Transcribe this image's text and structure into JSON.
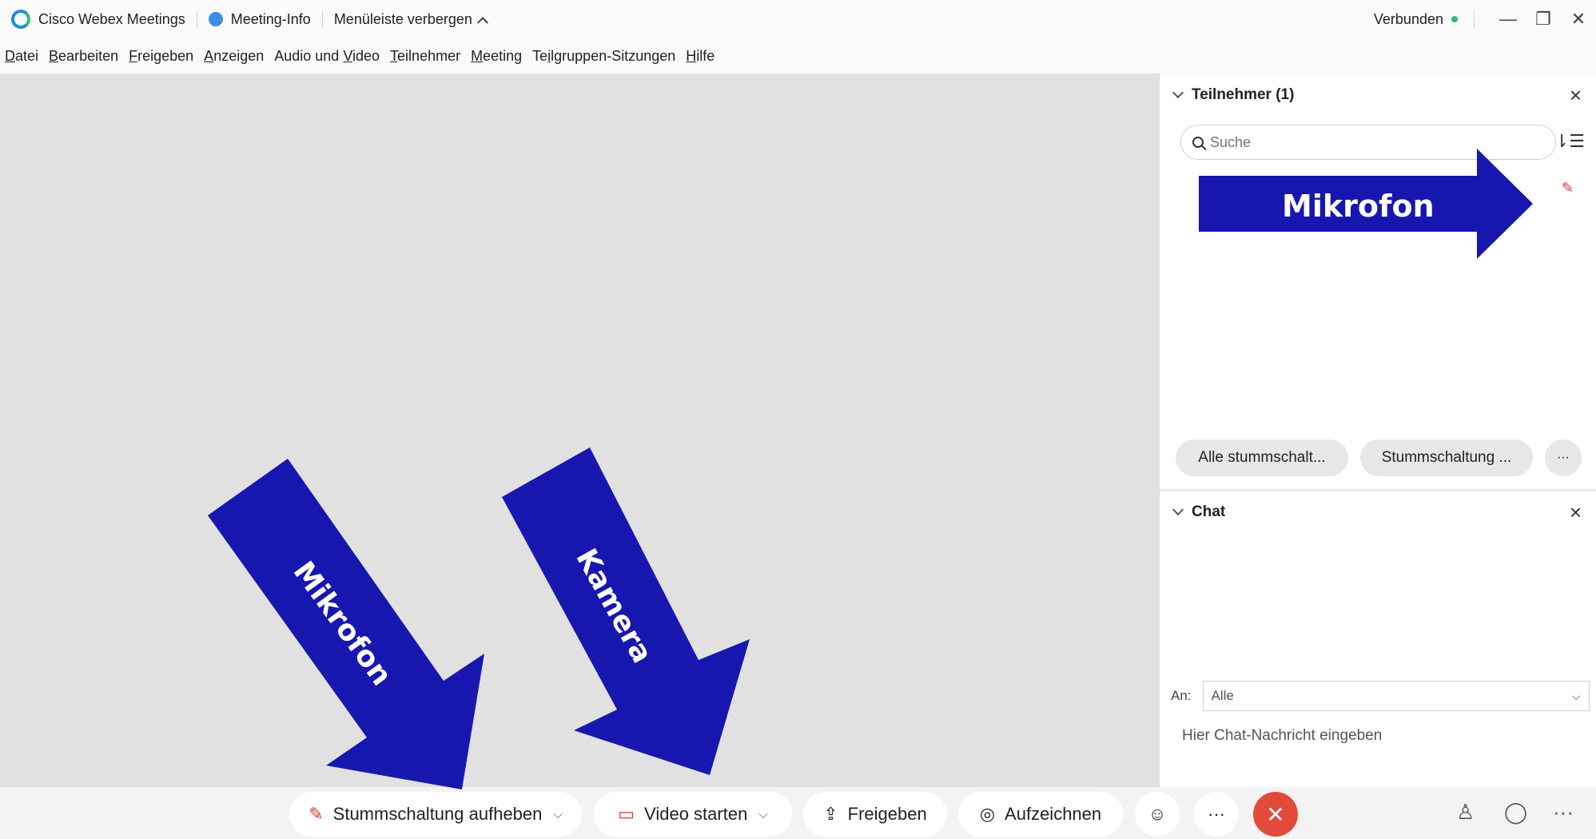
{
  "window": {
    "app_name": "Cisco Webex Meetings",
    "meeting_info": "Meeting-Info",
    "hide_menu": "Menüleiste verbergen",
    "status": "Verbunden"
  },
  "menu": [
    {
      "u": "D",
      "rest": "atei"
    },
    {
      "u": "B",
      "rest": "earbeiten"
    },
    {
      "u": "F",
      "rest": "reigeben"
    },
    {
      "u": "A",
      "rest": "nzeigen"
    },
    {
      "pre": "Audio und ",
      "u": "V",
      "rest": "ideo"
    },
    {
      "u": "T",
      "rest": "eilnehmer"
    },
    {
      "u": "M",
      "rest": "eeting"
    },
    {
      "pre": "Te",
      "u": "i",
      "rest": "lgruppen-Sitzungen"
    },
    {
      "u": "H",
      "rest": "ilfe"
    }
  ],
  "participants": {
    "title": "Teilnehmer (1)",
    "search_placeholder": "Suche",
    "mute_all": "Alle stummschalt...",
    "unmute_all": "Stummschaltung ...",
    "more": "···"
  },
  "chat": {
    "title": "Chat",
    "to_label": "An:",
    "to_value": "Alle",
    "input_placeholder": "Hier Chat-Nachricht eingeben"
  },
  "toolbar": {
    "unmute": "Stummschaltung aufheben",
    "video": "Video starten",
    "share": "Freigeben",
    "record": "Aufzeichnen",
    "more": "···"
  },
  "annotations": {
    "mic_panel": "Mikrofon",
    "mic_toolbar": "Mikrofon",
    "camera": "Kamera"
  },
  "colors": {
    "arrow": "#1717b0",
    "end_button": "#e24a3b",
    "connected": "#2fbf71",
    "muted": "#d33"
  },
  "icons": {
    "mic_muted": "mic-muted-icon",
    "video_off": "video-off-icon",
    "share": "share-icon",
    "record": "record-icon",
    "reactions": "smiley-icon",
    "participants": "person-icon",
    "chat": "chat-bubble-icon"
  }
}
